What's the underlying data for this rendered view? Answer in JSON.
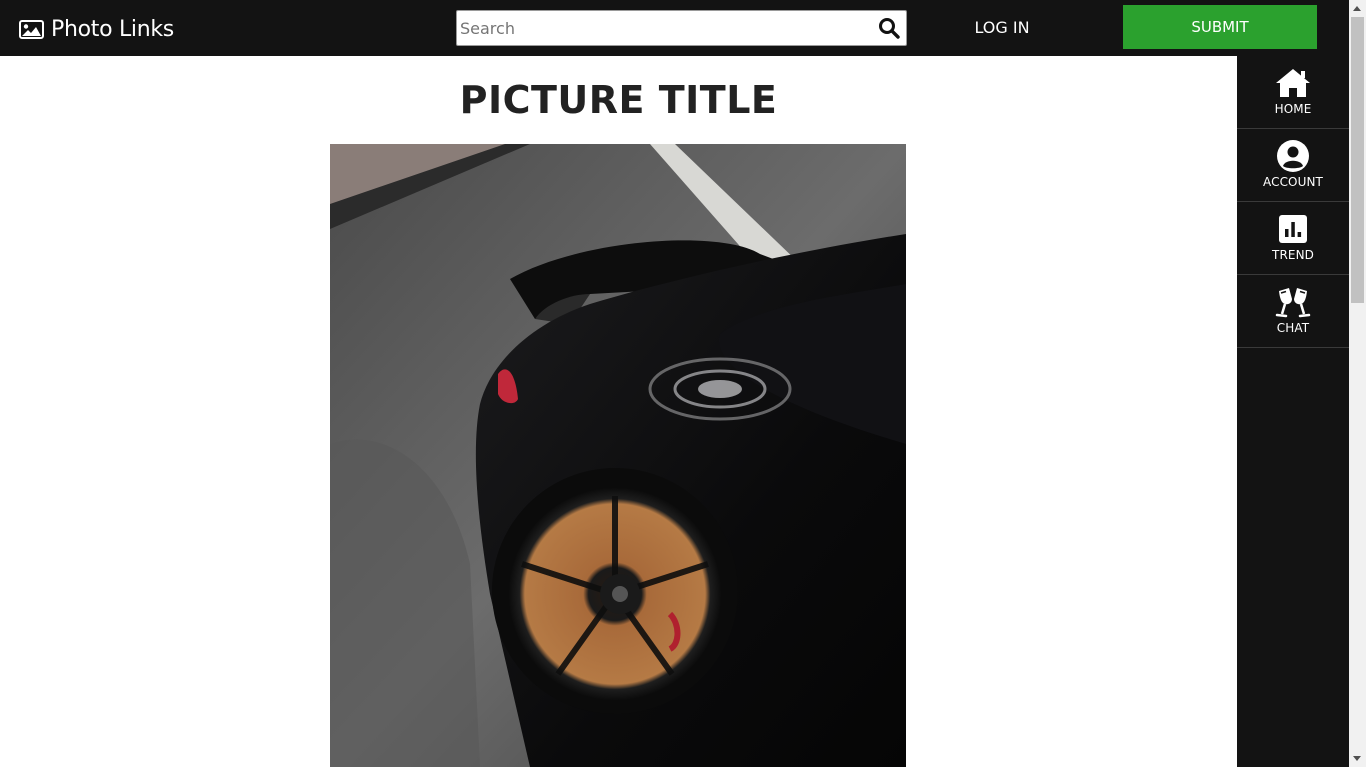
{
  "header": {
    "logo_text": "Photo Links",
    "search_placeholder": "Search",
    "search_value": "",
    "login_label": "LOG IN",
    "submit_label": "SUBMIT",
    "submit_color": "#2ba12e",
    "bar_color": "#131313"
  },
  "sidebar": {
    "items": [
      {
        "label": "HOME",
        "icon": "home-icon"
      },
      {
        "label": "ACCOUNT",
        "icon": "account-circle-icon"
      },
      {
        "label": "TREND",
        "icon": "bar-chart-icon"
      },
      {
        "label": "CHAT",
        "icon": "cheers-glasses-icon"
      }
    ]
  },
  "main": {
    "title": "PICTURE TITLE",
    "photo": "black-sports-car-rear-wheel-photo"
  }
}
